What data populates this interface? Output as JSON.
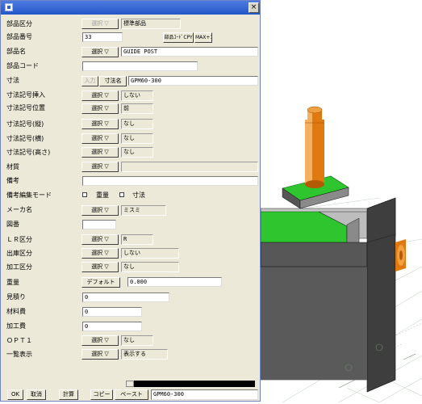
{
  "colors": {
    "title_bar": "#2456c8",
    "dialog_bg": "#ece9d8",
    "part_green": "#2fc52f",
    "pin_orange": "#e07a10",
    "block_gray": "#555555"
  },
  "window": {
    "close": "×"
  },
  "rows": [
    {
      "label": "部品区分",
      "select": "選択 ▽",
      "value": "標準部品"
    },
    {
      "label": "部品番号",
      "input": "33",
      "btn1": "部品ｺｰﾄﾞCPY",
      "btn2": "MAX+1"
    },
    {
      "label": "部品名",
      "select": "選択 ▽",
      "value": "GUIDE POST"
    },
    {
      "label": "部品コード",
      "input": ""
    },
    {
      "label": "寸法",
      "btn_in": "入力",
      "btn_name": "寸法名",
      "value": "GPM60-300"
    },
    {
      "label": "寸法記号挿入",
      "select": "選択 ▽",
      "value": "しない"
    },
    {
      "label": "寸法記号位置",
      "select": "選択 ▽",
      "value": "前"
    },
    {
      "label": "寸法記号(縦)",
      "select": "選択 ▽",
      "value": "なし"
    },
    {
      "label": "寸法記号(横)",
      "select": "選択 ▽",
      "value": "なし"
    },
    {
      "label": "寸法記号(高さ)",
      "select": "選択 ▽",
      "value": "なし"
    },
    {
      "label": "材質",
      "select": "選択 ▽",
      "value": ""
    },
    {
      "label": "備考",
      "input": ""
    },
    {
      "label": "備考編集モード",
      "chk1": "重量",
      "chk2": "寸法"
    },
    {
      "label": "メーカ名",
      "select": "選択 ▽",
      "value": "ミスミ"
    },
    {
      "label": "図番",
      "input": ""
    },
    {
      "label": "ＬＲ区分",
      "select": "選択 ▽",
      "value": "R"
    },
    {
      "label": "出庫区分",
      "select": "選択 ▽",
      "value": "しない"
    },
    {
      "label": "加工区分",
      "select": "選択 ▽",
      "value": "なし"
    },
    {
      "label": "重量",
      "btn": "デフォルト",
      "value": "0.000"
    },
    {
      "label": "見積り",
      "input": "0"
    },
    {
      "label": "材料費",
      "input": "0"
    },
    {
      "label": "加工費",
      "input": "0"
    },
    {
      "label": "ＯＰＴ１",
      "select": "選択 ▽",
      "value": "なし"
    },
    {
      "label": "一覧表示",
      "select": "選択 ▽",
      "value": "表示する"
    }
  ],
  "footer": {
    "ok": "OK",
    "cancel": "取消",
    "calc": "計算",
    "copy": "コピー",
    "paste": "ペースト",
    "status": "GPM60-300"
  }
}
